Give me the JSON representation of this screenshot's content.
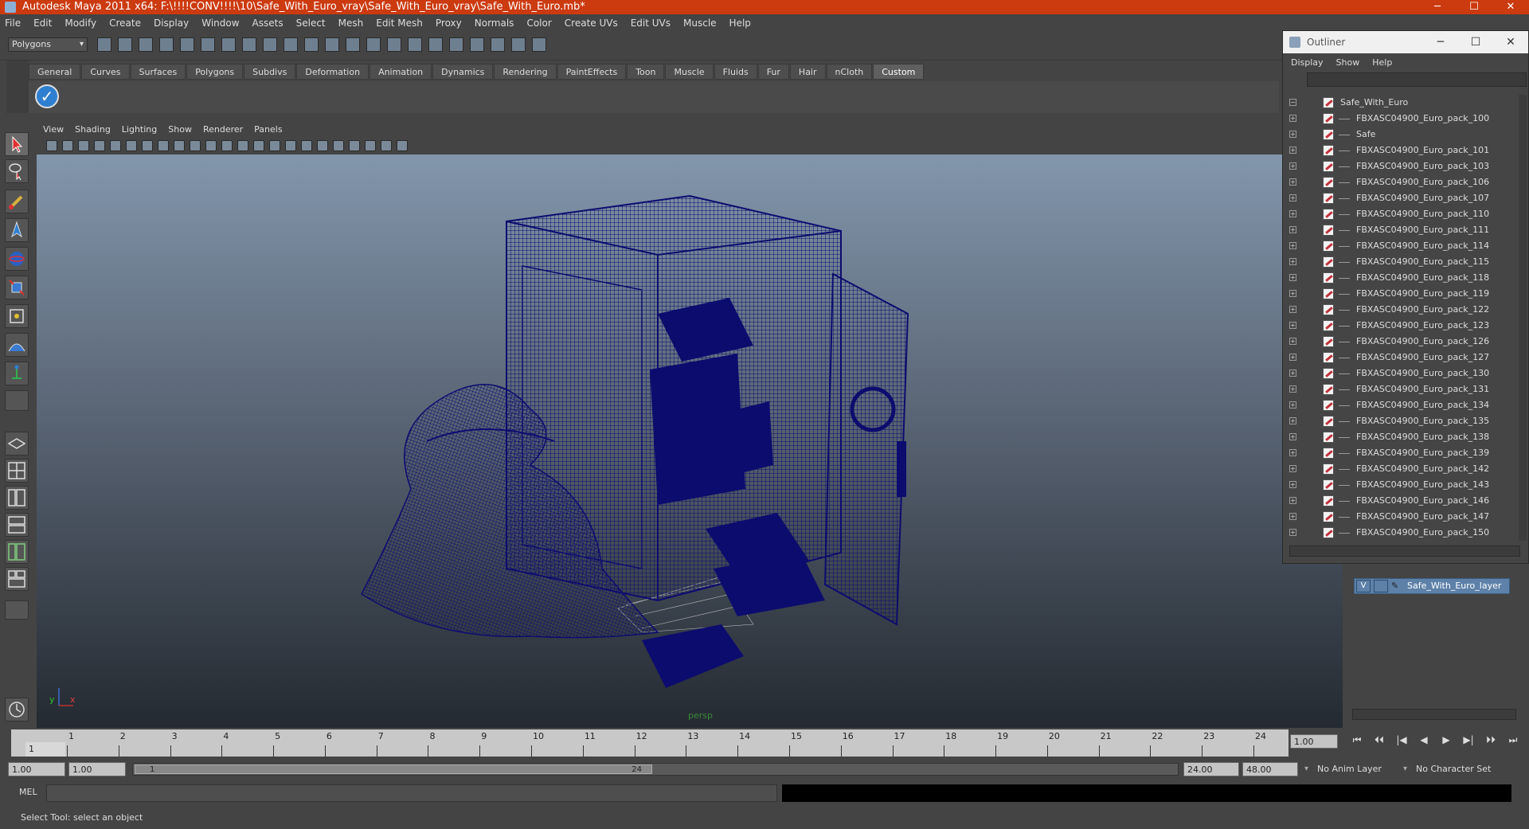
{
  "window": {
    "title": "Autodesk Maya 2011 x64: F:\\!!!!CONV!!!!\\10\\Safe_With_Euro_vray\\Safe_With_Euro_vray\\Safe_With_Euro.mb*",
    "minimize": "─",
    "maximize": "☐",
    "close": "✕"
  },
  "menubar": [
    "File",
    "Edit",
    "Modify",
    "Create",
    "Display",
    "Window",
    "Assets",
    "Select",
    "Mesh",
    "Edit Mesh",
    "Proxy",
    "Normals",
    "Color",
    "Create UVs",
    "Edit UVs",
    "Muscle",
    "Help"
  ],
  "status": {
    "mode": "Polygons"
  },
  "shelf": {
    "tabs": [
      "General",
      "Curves",
      "Surfaces",
      "Polygons",
      "Subdivs",
      "Deformation",
      "Animation",
      "Dynamics",
      "Rendering",
      "PaintEffects",
      "Toon",
      "Muscle",
      "Fluids",
      "Fur",
      "Hair",
      "nCloth",
      "Custom"
    ],
    "active": "Custom"
  },
  "viewport": {
    "menu": [
      "View",
      "Shading",
      "Lighting",
      "Show",
      "Renderer",
      "Panels"
    ],
    "camera": "persp",
    "axis_y": "y",
    "axis_x": "x",
    "wire_color": "#0c0c6e"
  },
  "outliner": {
    "title": "Outliner",
    "menu": [
      "Display",
      "Show",
      "Help"
    ],
    "items": [
      {
        "label": "Safe_With_Euro",
        "level": 0
      },
      {
        "label": "FBXASC04900_Euro_pack_100",
        "level": 1
      },
      {
        "label": "Safe",
        "level": 1
      },
      {
        "label": "FBXASC04900_Euro_pack_101",
        "level": 1
      },
      {
        "label": "FBXASC04900_Euro_pack_103",
        "level": 1
      },
      {
        "label": "FBXASC04900_Euro_pack_106",
        "level": 1
      },
      {
        "label": "FBXASC04900_Euro_pack_107",
        "level": 1
      },
      {
        "label": "FBXASC04900_Euro_pack_110",
        "level": 1
      },
      {
        "label": "FBXASC04900_Euro_pack_111",
        "level": 1
      },
      {
        "label": "FBXASC04900_Euro_pack_114",
        "level": 1
      },
      {
        "label": "FBXASC04900_Euro_pack_115",
        "level": 1
      },
      {
        "label": "FBXASC04900_Euro_pack_118",
        "level": 1
      },
      {
        "label": "FBXASC04900_Euro_pack_119",
        "level": 1
      },
      {
        "label": "FBXASC04900_Euro_pack_122",
        "level": 1
      },
      {
        "label": "FBXASC04900_Euro_pack_123",
        "level": 1
      },
      {
        "label": "FBXASC04900_Euro_pack_126",
        "level": 1
      },
      {
        "label": "FBXASC04900_Euro_pack_127",
        "level": 1
      },
      {
        "label": "FBXASC04900_Euro_pack_130",
        "level": 1
      },
      {
        "label": "FBXASC04900_Euro_pack_131",
        "level": 1
      },
      {
        "label": "FBXASC04900_Euro_pack_134",
        "level": 1
      },
      {
        "label": "FBXASC04900_Euro_pack_135",
        "level": 1
      },
      {
        "label": "FBXASC04900_Euro_pack_138",
        "level": 1
      },
      {
        "label": "FBXASC04900_Euro_pack_139",
        "level": 1
      },
      {
        "label": "FBXASC04900_Euro_pack_142",
        "level": 1
      },
      {
        "label": "FBXASC04900_Euro_pack_143",
        "level": 1
      },
      {
        "label": "FBXASC04900_Euro_pack_146",
        "level": 1
      },
      {
        "label": "FBXASC04900_Euro_pack_147",
        "level": 1
      },
      {
        "label": "FBXASC04900_Euro_pack_150",
        "level": 1
      }
    ]
  },
  "layers": {
    "visible_flag": "V",
    "layer_name": "Safe_With_Euro_layer",
    "layer_color": "#5d81a8"
  },
  "timeline": {
    "ticks": [
      "1",
      "2",
      "3",
      "4",
      "5",
      "6",
      "7",
      "8",
      "9",
      "10",
      "11",
      "12",
      "13",
      "14",
      "15",
      "16",
      "17",
      "18",
      "19",
      "20",
      "21",
      "22",
      "23",
      "24"
    ],
    "current_frame_marker": "1",
    "current_frame": "1.00"
  },
  "playback": [
    "⏮",
    "⏴⏴",
    "|◀",
    "◀",
    "▶",
    "▶|",
    "⏵⏵",
    "⏭"
  ],
  "range": {
    "start_time": "1.00",
    "playback_start": "1.00",
    "handle_start": "1",
    "handle_end": "24",
    "playback_end": "24.00",
    "end_time": "48.00",
    "anim_layer": "No Anim Layer",
    "character_set": "No Character Set"
  },
  "command": {
    "label": "MEL"
  },
  "helpline": {
    "text": "Select Tool: select an object"
  }
}
